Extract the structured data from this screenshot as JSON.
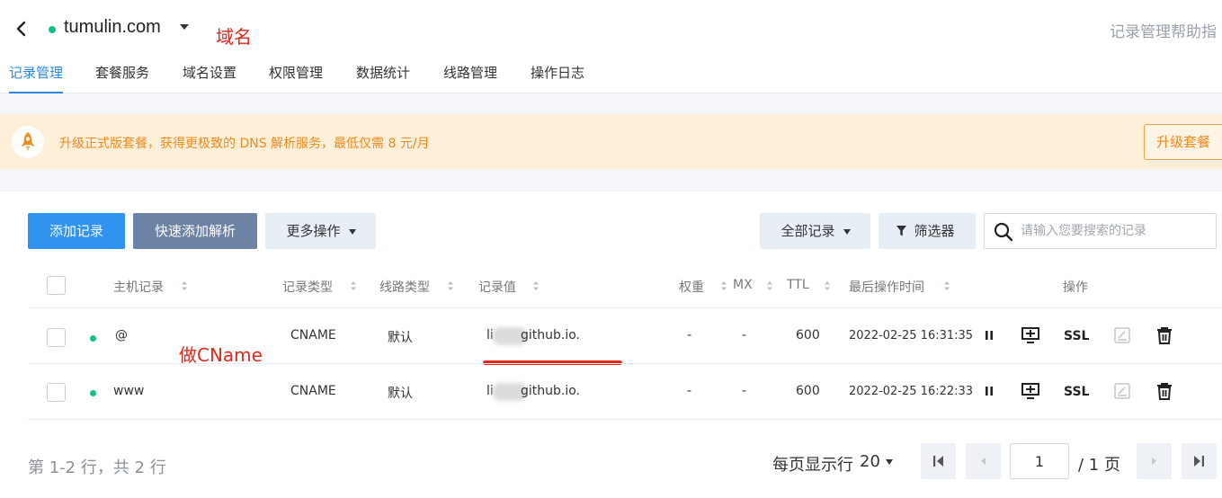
{
  "header": {
    "domain": "tumulin.com",
    "annotation": "域名",
    "help": "记录管理帮助指"
  },
  "tabs": [
    {
      "label": "记录管理",
      "active": true
    },
    {
      "label": "套餐服务",
      "active": false
    },
    {
      "label": "域名设置",
      "active": false
    },
    {
      "label": "权限管理",
      "active": false
    },
    {
      "label": "数据统计",
      "active": false
    },
    {
      "label": "线路管理",
      "active": false
    },
    {
      "label": "操作日志",
      "active": false
    }
  ],
  "banner": {
    "text": "升级正式版套餐，获得更极致的 DNS 解析服务，最低仅需 8 元/月",
    "button": "升级套餐"
  },
  "toolbar": {
    "add": "添加记录",
    "quick": "快速添加解析",
    "more": "更多操作",
    "all": "全部记录",
    "filter": "筛选器",
    "search_placeholder": "请输入您要搜索的记录"
  },
  "table": {
    "headers": {
      "host": "主机记录",
      "type": "记录类型",
      "line": "线路类型",
      "value": "记录值",
      "weight": "权重",
      "mx": "MX",
      "ttl": "TTL",
      "time": "最后操作时间",
      "actions": "操作"
    },
    "rows": [
      {
        "host": "@",
        "type": "CNAME",
        "line": "默认",
        "value_prefix": "li",
        "value_suffix": "github.io.",
        "weight": "-",
        "mx": "-",
        "ttl": "600",
        "time": "2022-02-25 16:31:35",
        "ssl": "SSL"
      },
      {
        "host": "www",
        "type": "CNAME",
        "line": "默认",
        "value_prefix": "li",
        "value_suffix": "github.io.",
        "weight": "-",
        "mx": "-",
        "ttl": "600",
        "time": "2022-02-25 16:22:33",
        "ssl": "SSL"
      }
    ],
    "annotation": "做CName"
  },
  "pagination": {
    "summary": "第 1-2 行，共 2 行",
    "per_page_label": "每页显示行",
    "per_page": "20",
    "current": "1",
    "total": "/ 1 页"
  },
  "colors": {
    "accent": "#2d88e6",
    "status_green": "#14c08a",
    "warning": "#f08a1c",
    "annotation_red": "#e3271c"
  }
}
